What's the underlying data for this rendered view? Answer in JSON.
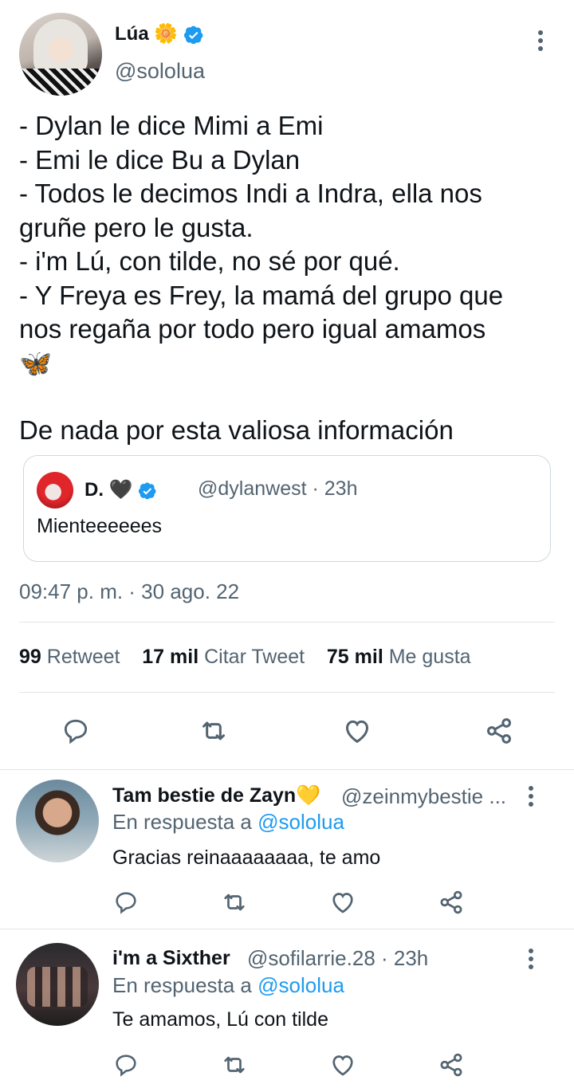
{
  "tweet": {
    "author_name": "Lúa",
    "author_emoji": "🌼",
    "author_handle": "@sololua",
    "body_lines": [
      "- Dylan le dice Mimi a Emi",
      "- Emi le dice Bu a Dylan",
      "- Todos le decimos Indi a Indra, ella nos",
      "gruñe pero le gusta.",
      "- i'm Lú, con tilde, no sé por qué.",
      "- Y Freya es Frey, la mamá del grupo que",
      "nos regaña por todo pero igual amamos",
      "🦋",
      "",
      "De nada por esta valiosa información"
    ],
    "quoted": {
      "name": "D. 🖤",
      "handle_time": "@dylanwest · 23h",
      "text": "Mienteeeeees"
    },
    "timestamp": "09:47 p. m. · 30 ago. 22",
    "stats": {
      "retweets_count": "99",
      "retweets_label": "Retweet",
      "quotes_count": "17 mil",
      "quotes_label": "Citar Tweet",
      "likes_count": "75 mil",
      "likes_label": "Me gusta"
    }
  },
  "replies": [
    {
      "name": "Tam bestie de Zayn💛",
      "handle": "@zeinmybestie ...",
      "in_reply_prefix": "En respuesta a",
      "in_reply_handle": "@sololua",
      "text": "Gracias reinaaaaaaaa, te amo"
    },
    {
      "name": "i'm a Sixther",
      "handle": "@sofilarrie.28 · 23h",
      "in_reply_prefix": "En respuesta a",
      "in_reply_handle": "@sololua",
      "text": "Te amamos, Lú con tilde"
    }
  ],
  "colors": {
    "text": "#0f1419",
    "secondary": "#536471",
    "link": "#1d9bf0",
    "verified": "#1d9bf0",
    "divider": "#dfe5e8"
  },
  "icons": [
    "verified-badge-icon",
    "more-options-icon",
    "reply-icon",
    "retweet-icon",
    "like-icon",
    "share-icon",
    "butterfly-emoji"
  ]
}
